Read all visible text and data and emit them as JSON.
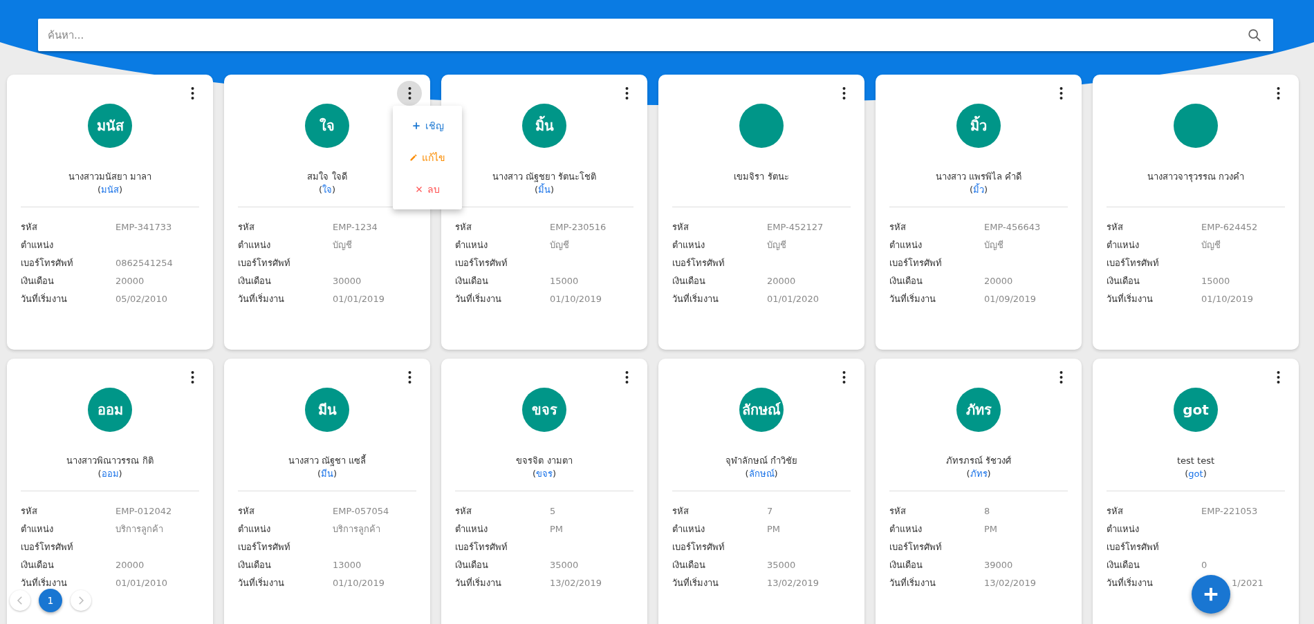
{
  "search": {
    "placeholder": "ค้นหา..."
  },
  "cards": [
    {
      "avatar": "มนัส",
      "name": "นางสาวมนัสยา มาลา",
      "nickname": "(มนัส)",
      "menu_open": false,
      "fields": [
        {
          "label": "รหัส",
          "value": "EMP-341733"
        },
        {
          "label": "ตำแหน่ง"
        },
        {
          "label": "เบอร์โทรศัพท์",
          "value": "0862541254"
        },
        {
          "label": "เงินเดือน",
          "value": "20000"
        },
        {
          "label": "วันที่เริ่มงาน",
          "value": "05/02/2010"
        }
      ]
    },
    {
      "avatar": "ใจ",
      "name": "สมใจ ใจดี",
      "nickname": "(ใจ)",
      "menu_open": true,
      "menu": [
        {
          "kind": "add",
          "label": "เชิญ",
          "color": "#1976d2"
        },
        {
          "kind": "edit",
          "label": "แก้ไข",
          "color": "#fb8c00"
        },
        {
          "kind": "delete",
          "label": "ลบ",
          "color": "#ff5252"
        }
      ],
      "fields": [
        {
          "label": "รหัส",
          "value": "EMP-1234"
        },
        {
          "label": "ตำแหน่ง",
          "value": "บัญชี"
        },
        {
          "label": "เบอร์โทรศัพท์"
        },
        {
          "label": "เงินเดือน",
          "value": "30000"
        },
        {
          "label": "วันที่เริ่มงาน",
          "value": "01/01/2019"
        }
      ]
    },
    {
      "avatar": "มิ้น",
      "name": "นางสาว ณัฐชยา รัตนะโชติ",
      "nickname": "(มิ้น)",
      "menu_open": false,
      "fields": [
        {
          "label": "รหัส",
          "value": "EMP-230516"
        },
        {
          "label": "ตำแหน่ง",
          "value": "บัญชี"
        },
        {
          "label": "เบอร์โทรศัพท์"
        },
        {
          "label": "เงินเดือน",
          "value": "15000"
        },
        {
          "label": "วันที่เริ่มงาน",
          "value": "01/10/2019"
        }
      ]
    },
    {
      "name": "เขมจิรา รัตนะ",
      "menu_open": false,
      "fields": [
        {
          "label": "รหัส",
          "value": "EMP-452127"
        },
        {
          "label": "ตำแหน่ง",
          "value": "บัญชี"
        },
        {
          "label": "เบอร์โทรศัพท์"
        },
        {
          "label": "เงินเดือน",
          "value": "20000"
        },
        {
          "label": "วันที่เริ่มงาน",
          "value": "01/01/2020"
        }
      ]
    },
    {
      "avatar": "มิ้ว",
      "name": "นางสาว แพรพิไล คำดี",
      "nickname": "(มิ้ว)",
      "menu_open": false,
      "fields": [
        {
          "label": "รหัส",
          "value": "EMP-456643"
        },
        {
          "label": "ตำแหน่ง",
          "value": "บัญชี"
        },
        {
          "label": "เบอร์โทรศัพท์"
        },
        {
          "label": "เงินเดือน",
          "value": "20000"
        },
        {
          "label": "วันที่เริ่มงาน",
          "value": "01/09/2019"
        }
      ]
    },
    {
      "name": "นางสาวจารุวรรณ กวงคำ",
      "menu_open": false,
      "fields": [
        {
          "label": "รหัส",
          "value": "EMP-624452"
        },
        {
          "label": "ตำแหน่ง",
          "value": "บัญชี"
        },
        {
          "label": "เบอร์โทรศัพท์"
        },
        {
          "label": "เงินเดือน",
          "value": "15000"
        },
        {
          "label": "วันที่เริ่มงาน",
          "value": "01/10/2019"
        }
      ]
    },
    {
      "avatar": "ออม",
      "name": "นางสาวพิณาวรรณ กิติ",
      "nickname": "(ออม)",
      "menu_open": false,
      "fields": [
        {
          "label": "รหัส",
          "value": "EMP-012042"
        },
        {
          "label": "ตำแหน่ง",
          "value": "บริการลูกค้า"
        },
        {
          "label": "เบอร์โทรศัพท์"
        },
        {
          "label": "เงินเดือน",
          "value": "20000"
        },
        {
          "label": "วันที่เริ่มงาน",
          "value": "01/01/2010"
        }
      ]
    },
    {
      "avatar": "มีน",
      "name": "นางสาว ณัฐชา แซลี้",
      "nickname": "(มีน)",
      "menu_open": false,
      "fields": [
        {
          "label": "รหัส",
          "value": "EMP-057054"
        },
        {
          "label": "ตำแหน่ง",
          "value": "บริการลูกค้า"
        },
        {
          "label": "เบอร์โทรศัพท์"
        },
        {
          "label": "เงินเดือน",
          "value": "13000"
        },
        {
          "label": "วันที่เริ่มงาน",
          "value": "01/10/2019"
        }
      ]
    },
    {
      "avatar": "ขจร",
      "name": "ขจรจิต งามตา",
      "nickname": "(ขจร)",
      "menu_open": false,
      "fields": [
        {
          "label": "รหัส",
          "value": "5"
        },
        {
          "label": "ตำแหน่ง",
          "value": "PM"
        },
        {
          "label": "เบอร์โทรศัพท์"
        },
        {
          "label": "เงินเดือน",
          "value": "35000"
        },
        {
          "label": "วันที่เริ่มงาน",
          "value": "13/02/2019"
        }
      ]
    },
    {
      "avatar": "ลักษณ์",
      "name": "จุฬาลักษณ์ กำวิชัย",
      "nickname": "(ลักษณ์)",
      "menu_open": false,
      "fields": [
        {
          "label": "รหัส",
          "value": "7"
        },
        {
          "label": "ตำแหน่ง",
          "value": "PM"
        },
        {
          "label": "เบอร์โทรศัพท์"
        },
        {
          "label": "เงินเดือน",
          "value": "35000"
        },
        {
          "label": "วันที่เริ่มงาน",
          "value": "13/02/2019"
        }
      ]
    },
    {
      "avatar": "ภัทร",
      "name": "ภัทรภรณ์ รัชวงศ์",
      "nickname": "(ภัทร)",
      "menu_open": false,
      "fields": [
        {
          "label": "รหัส",
          "value": "8"
        },
        {
          "label": "ตำแหน่ง",
          "value": "PM"
        },
        {
          "label": "เบอร์โทรศัพท์"
        },
        {
          "label": "เงินเดือน",
          "value": "39000"
        },
        {
          "label": "วันที่เริ่มงาน",
          "value": "13/02/2019"
        }
      ]
    },
    {
      "avatar": "got",
      "name": "test test",
      "nickname": "(got)",
      "menu_open": false,
      "fields": [
        {
          "label": "รหัส",
          "value": "EMP-221053"
        },
        {
          "label": "ตำแหน่ง"
        },
        {
          "label": "เบอร์โทรศัพท์"
        },
        {
          "label": "เงินเดือน",
          "value": "0"
        },
        {
          "label": "วันที่เริ่มงาน",
          "value": "1/2021",
          "behind_button": true
        }
      ]
    }
  ],
  "pagination": {
    "previous": {
      "disabled": true
    },
    "pages": [
      {
        "label": "1",
        "selected": true
      }
    ],
    "next": {
      "disabled": true
    }
  }
}
